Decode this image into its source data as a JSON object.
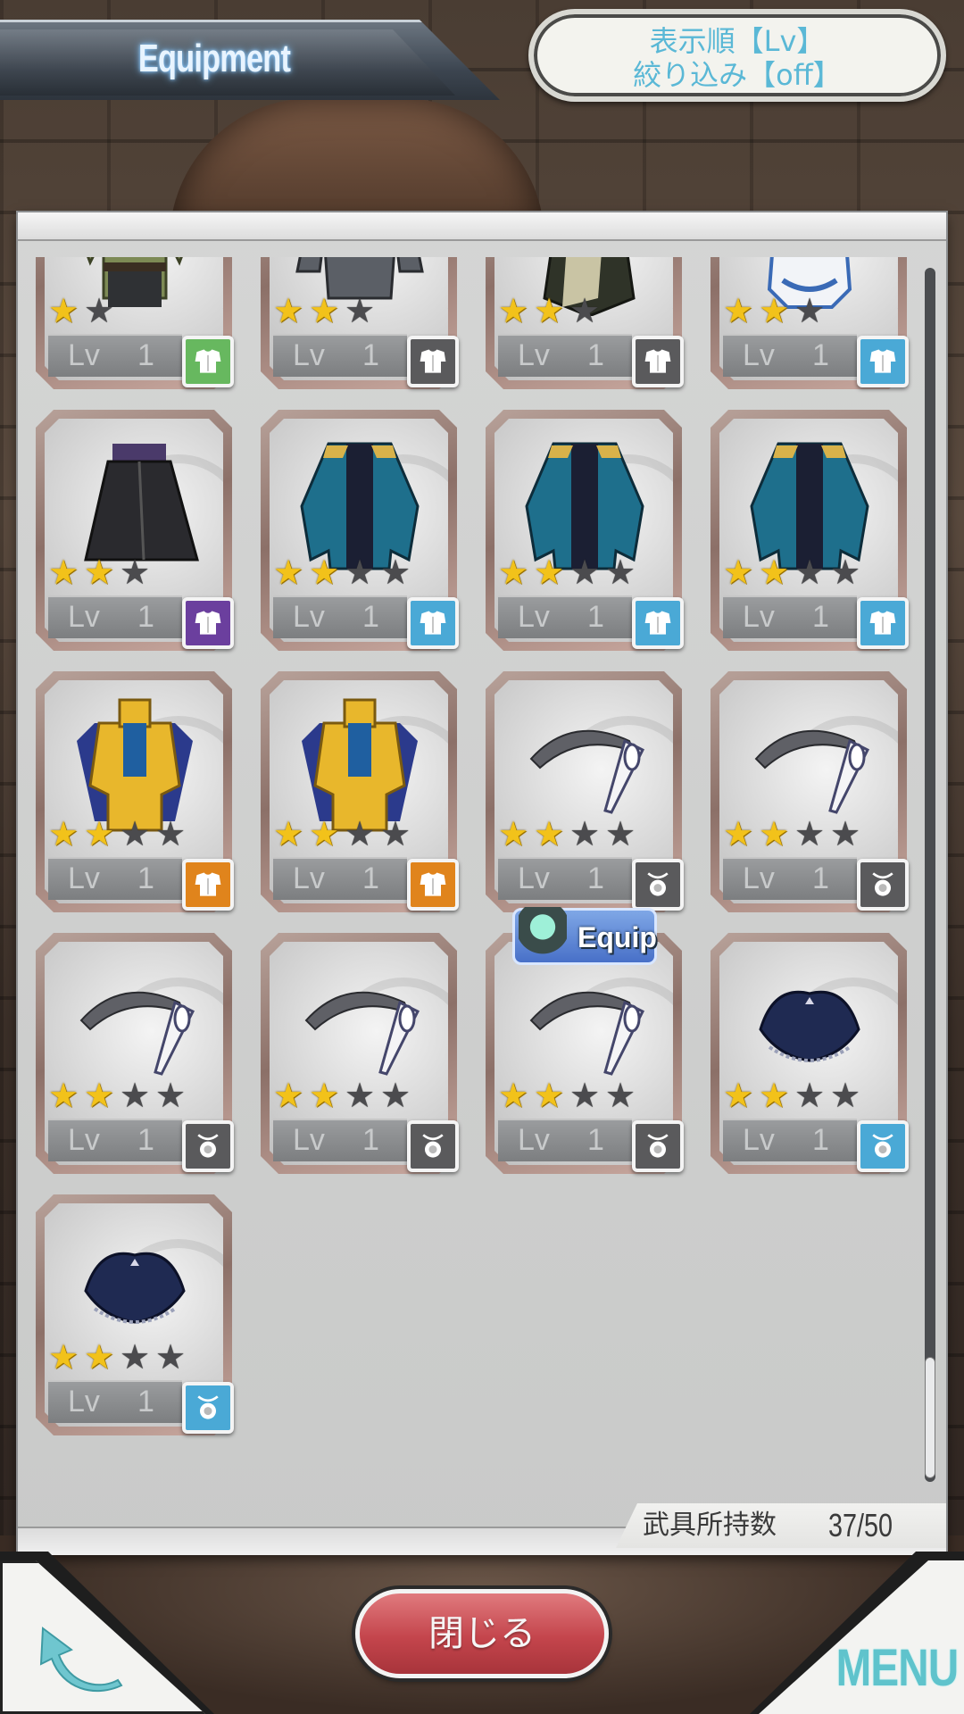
{
  "header": {
    "title": "Equipment"
  },
  "sort_panel": {
    "sort_label": "表示順【Lv】",
    "filter_label": "絞り込み【off】"
  },
  "colors": {
    "badge_green": "#67b85f",
    "badge_gray": "#5a5a5c",
    "badge_blue": "#4aa9d6",
    "badge_purple": "#6b3f9e",
    "badge_orange": "#e0841c",
    "star_on": "#f2c21a",
    "star_off": "#4b4b4e",
    "close_button": "#c4454c",
    "menu_text": "#5fc3cc"
  },
  "items": [
    {
      "art": "green-armor",
      "stars": 1,
      "max_stars": 2,
      "badge": "armor-icon",
      "badge_color": "green",
      "lv_label": "Lv",
      "lv": "1",
      "equipped": false
    },
    {
      "art": "gray-armor",
      "stars": 2,
      "max_stars": 3,
      "badge": "armor-icon",
      "badge_color": "gray",
      "lv_label": "Lv",
      "lv": "1",
      "equipped": false
    },
    {
      "art": "dark-cloak",
      "stars": 2,
      "max_stars": 3,
      "badge": "armor-icon",
      "badge_color": "gray",
      "lv_label": "Lv",
      "lv": "1",
      "equipped": false
    },
    {
      "art": "white-robe",
      "stars": 2,
      "max_stars": 3,
      "badge": "armor-icon",
      "badge_color": "blue",
      "lv_label": "Lv",
      "lv": "1",
      "equipped": false
    },
    {
      "art": "black-skirt",
      "stars": 2,
      "max_stars": 3,
      "badge": "armor-icon",
      "badge_color": "purple",
      "lv_label": "Lv",
      "lv": "1",
      "equipped": false
    },
    {
      "art": "blue-coat",
      "stars": 2,
      "max_stars": 4,
      "badge": "armor-icon",
      "badge_color": "blue",
      "lv_label": "Lv",
      "lv": "1",
      "equipped": false
    },
    {
      "art": "blue-coat",
      "stars": 2,
      "max_stars": 4,
      "badge": "armor-icon",
      "badge_color": "blue",
      "lv_label": "Lv",
      "lv": "1",
      "equipped": false
    },
    {
      "art": "blue-coat",
      "stars": 2,
      "max_stars": 4,
      "badge": "armor-icon",
      "badge_color": "blue",
      "lv_label": "Lv",
      "lv": "1",
      "equipped": false
    },
    {
      "art": "gold-armor",
      "stars": 2,
      "max_stars": 4,
      "badge": "armor-icon",
      "badge_color": "orange",
      "lv_label": "Lv",
      "lv": "1",
      "equipped": false
    },
    {
      "art": "gold-armor",
      "stars": 2,
      "max_stars": 4,
      "badge": "armor-icon",
      "badge_color": "orange",
      "lv_label": "Lv",
      "lv": "1",
      "equipped": false
    },
    {
      "art": "headband",
      "stars": 2,
      "max_stars": 4,
      "badge": "accessory-icon",
      "badge_color": "gray",
      "lv_label": "Lv",
      "lv": "1",
      "equipped": false
    },
    {
      "art": "headband",
      "stars": 2,
      "max_stars": 4,
      "badge": "accessory-icon",
      "badge_color": "gray",
      "lv_label": "Lv",
      "lv": "1",
      "equipped": false
    },
    {
      "art": "headband",
      "stars": 2,
      "max_stars": 4,
      "badge": "accessory-icon",
      "badge_color": "gray",
      "lv_label": "Lv",
      "lv": "1",
      "equipped": false
    },
    {
      "art": "headband",
      "stars": 2,
      "max_stars": 4,
      "badge": "accessory-icon",
      "badge_color": "gray",
      "lv_label": "Lv",
      "lv": "1",
      "equipped": false
    },
    {
      "art": "headband",
      "stars": 2,
      "max_stars": 4,
      "badge": "accessory-icon",
      "badge_color": "gray",
      "lv_label": "Lv",
      "lv": "1",
      "equipped": true,
      "equip_label": "Equip"
    },
    {
      "art": "tricorn-hat",
      "stars": 2,
      "max_stars": 4,
      "badge": "accessory-icon",
      "badge_color": "blue",
      "lv_label": "Lv",
      "lv": "1",
      "equipped": false
    },
    {
      "art": "tricorn-hat",
      "stars": 2,
      "max_stars": 4,
      "badge": "accessory-icon",
      "badge_color": "blue",
      "lv_label": "Lv",
      "lv": "1",
      "equipped": false
    }
  ],
  "footer": {
    "count_label": "武具所持数",
    "count_value": "37/50",
    "close_label": "閉じる",
    "menu_label": "MENU",
    "back_icon": "back-arrow-icon"
  }
}
